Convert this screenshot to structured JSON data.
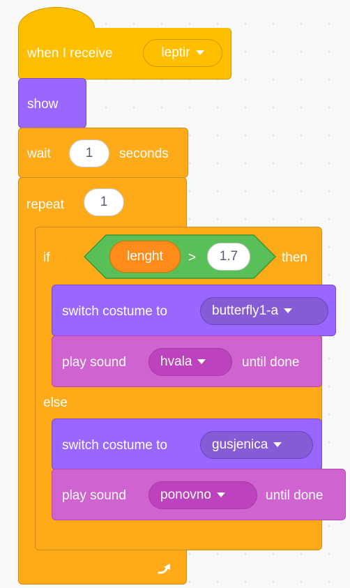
{
  "when_receive": {
    "label": "when I receive",
    "message": "leptir"
  },
  "show": {
    "label": "show"
  },
  "wait": {
    "label": "wait",
    "value": "1",
    "suffix": "seconds"
  },
  "repeat": {
    "label": "repeat",
    "value": "1"
  },
  "if_block": {
    "if_label": "if",
    "then_label": "then",
    "else_label": "else",
    "condition": {
      "variable": "lenght",
      "operator": ">",
      "value": "1.7"
    }
  },
  "if_branch": {
    "costume": {
      "label": "switch costume to",
      "value": "butterfly1-a"
    },
    "sound": {
      "label": "play sound",
      "value": "hvala",
      "suffix": "until done"
    }
  },
  "else_branch": {
    "costume": {
      "label": "switch costume to",
      "value": "gusjenica"
    },
    "sound": {
      "label": "play sound",
      "value": "ponovno",
      "suffix": "until done"
    }
  },
  "colors": {
    "events": "#ffbf00",
    "looks": "#9966ff",
    "control": "#ffab19",
    "sound": "#cf63cf",
    "operators": "#59c059",
    "variables": "#ff8c1a"
  },
  "icons": {
    "repeat_loop": "loop-arrow-icon",
    "dropdown": "caret-down-icon"
  }
}
